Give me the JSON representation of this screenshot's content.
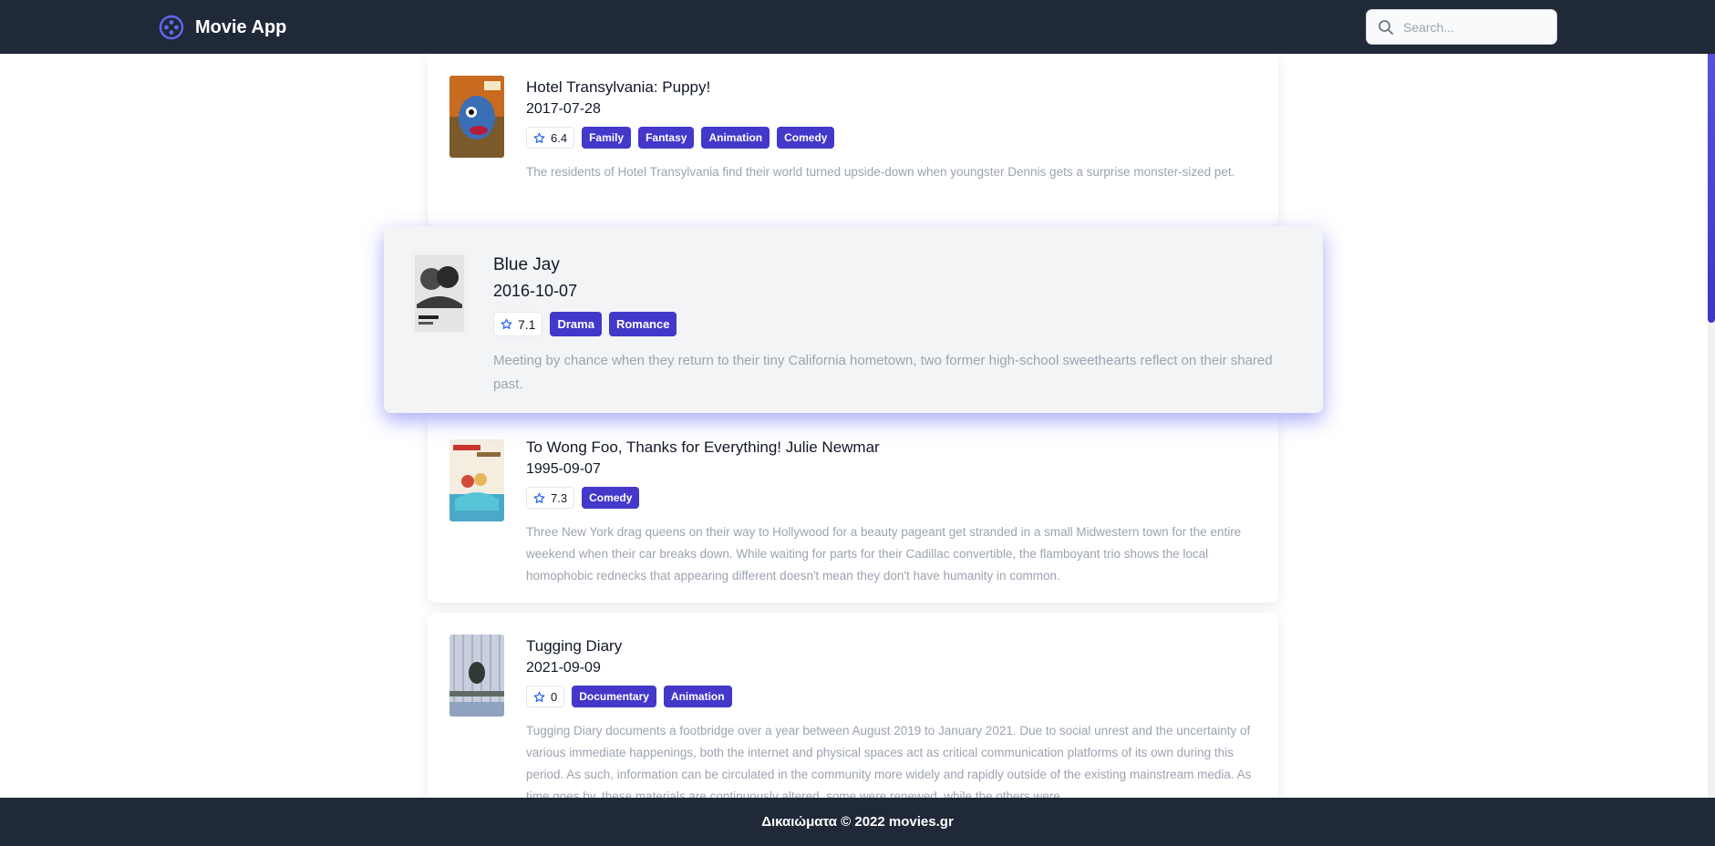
{
  "app": {
    "name": "Movie App"
  },
  "search": {
    "placeholder": "Search..."
  },
  "movies": [
    {
      "title": "Hotel Transylvania: Puppy!",
      "date": "2017-07-28",
      "rating": "6.4",
      "genres": [
        "Family",
        "Fantasy",
        "Animation",
        "Comedy"
      ],
      "overview": "The residents of Hotel Transylvania find their world turned upside-down when youngster Dennis gets a surprise monster-sized pet."
    },
    {
      "title": "Blue Jay",
      "date": "2016-10-07",
      "rating": "7.1",
      "genres": [
        "Drama",
        "Romance"
      ],
      "overview": "Meeting by chance when they return to their tiny California hometown, two former high-school sweethearts reflect on their shared past."
    },
    {
      "title": "To Wong Foo, Thanks for Everything! Julie Newmar",
      "date": "1995-09-07",
      "rating": "7.3",
      "genres": [
        "Comedy"
      ],
      "overview": "Three New York drag queens on their way to Hollywood for a beauty pageant get stranded in a small Midwestern town for the entire weekend when their car breaks down. While waiting for parts for their Cadillac convertible, the flamboyant trio shows the local homophobic rednecks that appearing different doesn't mean they don't have humanity in common."
    },
    {
      "title": "Tugging Diary",
      "date": "2021-09-09",
      "rating": "0",
      "genres": [
        "Documentary",
        "Animation"
      ],
      "overview": "Tugging Diary documents a footbridge over a year between August 2019 to January 2021. Due to social unrest and the uncertainty of various immediate happenings, both the internet and physical spaces act as critical communication platforms of its own during this period. As such, information can be circulated in the community more widely and rapidly outside of the existing mainstream media. As time goes by, these materials are continuously altered, some were renewed, while the others were"
    }
  ],
  "footer": {
    "text": "Δικαιώματα © 2022 movies.gr"
  },
  "colors": {
    "nav_bg": "#1f2937",
    "accent": "#4338ca",
    "active_glow": "#6366f1"
  }
}
